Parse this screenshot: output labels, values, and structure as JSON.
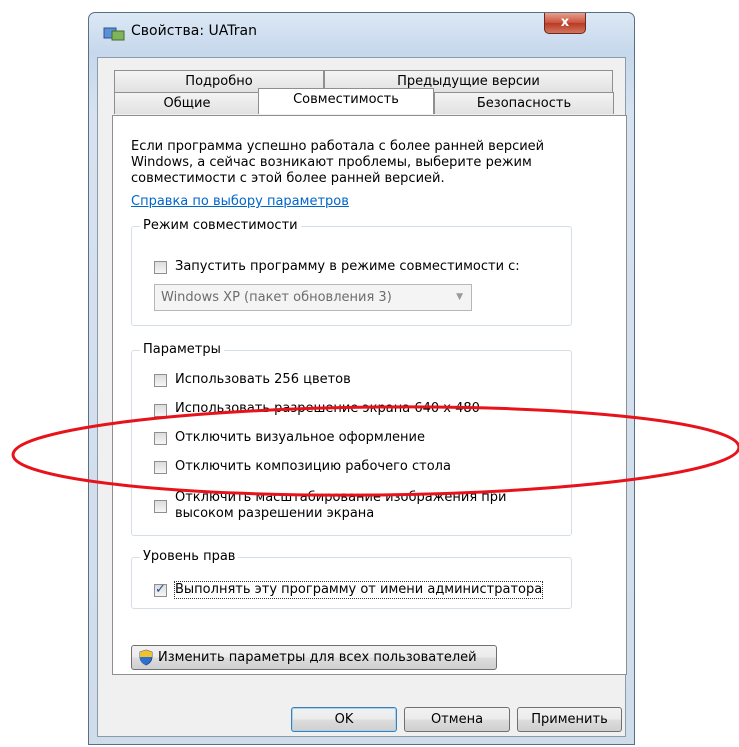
{
  "window": {
    "title": "Свойства: UATran",
    "close_label": "x"
  },
  "tabs": {
    "row1": [
      "Подробно",
      "Предыдущие версии"
    ],
    "row2": [
      "Общие",
      "Совместимость",
      "Безопасность"
    ],
    "active": "Совместимость"
  },
  "intro": {
    "line1": "Если программа успешно работала с более ранней версией",
    "line2": "Windows, а сейчас возникают проблемы, выберите режим",
    "line3": "совместимости с этой более ранней версией.",
    "help_link": "Справка по выбору параметров"
  },
  "compat_mode": {
    "title": "Режим совместимости",
    "checkbox_label": "Запустить программу в режиме совместимости с:",
    "checked": false,
    "select_value": "Windows XP (пакет обновления 3)"
  },
  "params": {
    "title": "Параметры",
    "options": [
      {
        "label": "Использовать 256 цветов",
        "checked": false
      },
      {
        "label": "Использовать разрешение экрана 640 x 480",
        "checked": false
      },
      {
        "label": "Отключить визуальное оформление",
        "checked": false
      },
      {
        "label": "Отключить композицию рабочего стола",
        "checked": false
      },
      {
        "label_line1": "Отключить масштабирование изображения при",
        "label_line2": "высоком разрешении экрана",
        "checked": false
      }
    ]
  },
  "privilege": {
    "title": "Уровень прав",
    "checkbox_label": "Выполнять эту программу от имени администратора",
    "checked": true,
    "check_glyph": "✓"
  },
  "all_users_button": "Изменить параметры для всех пользователей",
  "buttons": {
    "ok": "OK",
    "cancel": "Отмена",
    "apply": "Применить"
  },
  "annotation": {
    "color": "#e8121b"
  }
}
